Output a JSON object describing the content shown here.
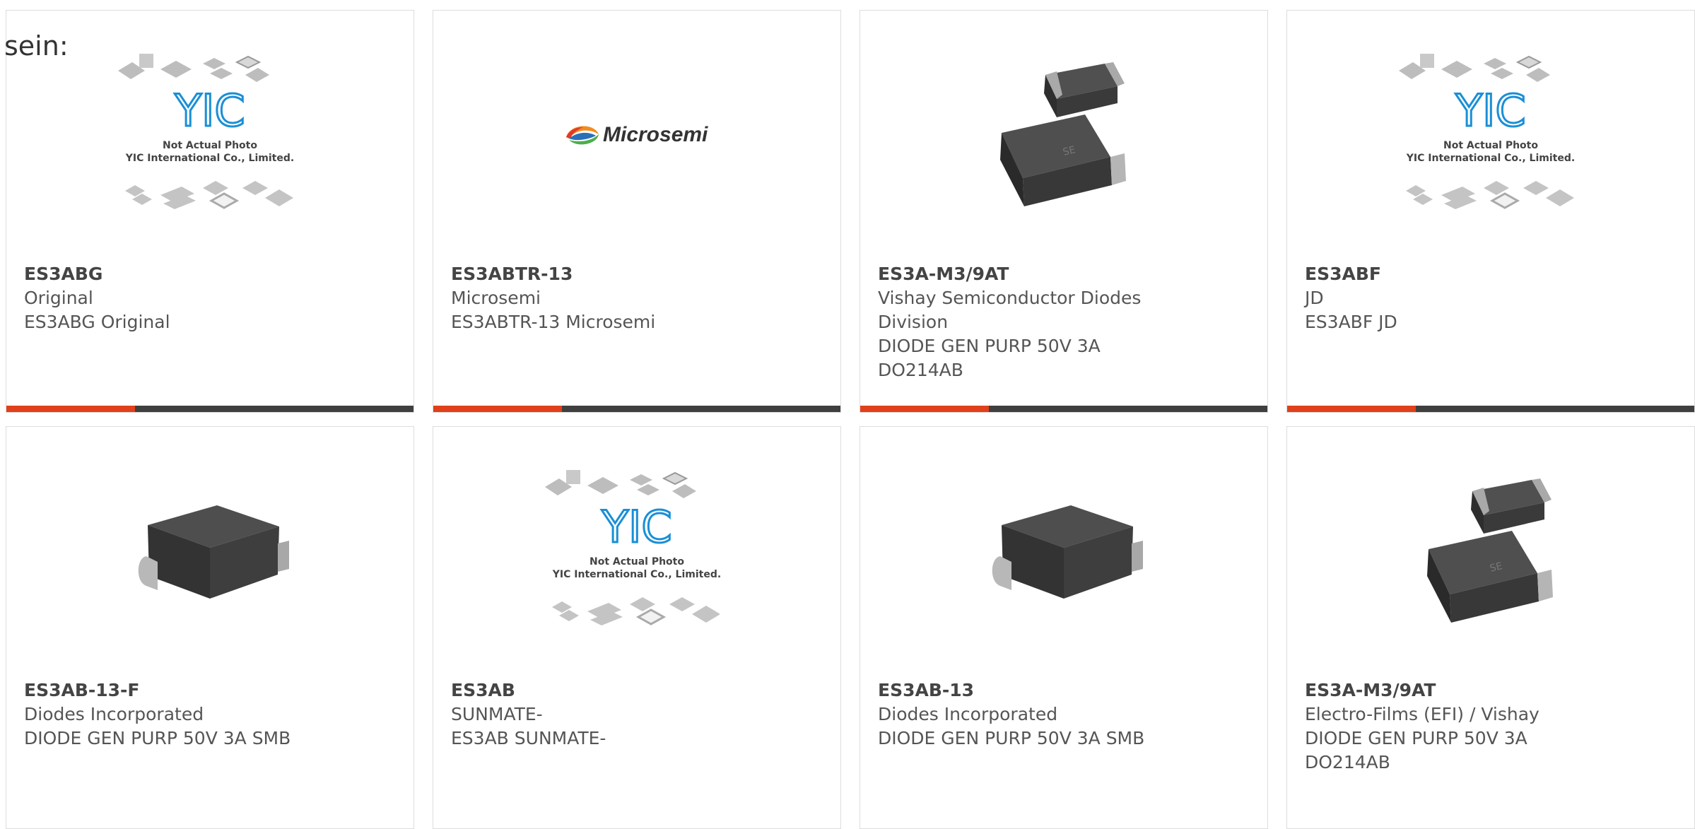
{
  "intro_text": "sein:",
  "colors": {
    "accent": "#e0401a",
    "bar": "#3f3f3f",
    "border": "#dddddd",
    "text": "#555555"
  },
  "products": [
    {
      "part_number": "ES3ABG",
      "manufacturer": "Original",
      "description": "ES3ABG Original",
      "image": "yic-placeholder-icon",
      "yic_text": {
        "logo": "YIC",
        "line1": "Not Actual Photo",
        "line2": "YIC International Co., Limited."
      }
    },
    {
      "part_number": "ES3ABTR-13",
      "manufacturer": "Microsemi",
      "description": "ES3ABTR-13 Microsemi",
      "image": "microsemi-logo-icon",
      "logo_text": "Microsemi"
    },
    {
      "part_number": "ES3A-M3/9AT",
      "manufacturer": "Vishay Semiconductor Diodes Division",
      "description": "DIODE GEN PURP 50V 3A DO214AB",
      "image": "smc-diode-pair-icon"
    },
    {
      "part_number": "ES3ABF",
      "manufacturer": "JD",
      "description": "ES3ABF JD",
      "image": "yic-placeholder-icon",
      "yic_text": {
        "logo": "YIC",
        "line1": "Not Actual Photo",
        "line2": "YIC International Co., Limited."
      }
    },
    {
      "part_number": "ES3AB-13-F",
      "manufacturer": "Diodes Incorporated",
      "description": "DIODE GEN PURP 50V 3A SMB",
      "image": "smb-diode-icon"
    },
    {
      "part_number": "ES3AB",
      "manufacturer": "SUNMATE-",
      "description": "ES3AB SUNMATE-",
      "image": "yic-placeholder-icon",
      "yic_text": {
        "logo": "YIC",
        "line1": "Not Actual Photo",
        "line2": "YIC International Co., Limited."
      }
    },
    {
      "part_number": "ES3AB-13",
      "manufacturer": "Diodes Incorporated",
      "description": "DIODE GEN PURP 50V 3A SMB",
      "image": "smb-diode-icon"
    },
    {
      "part_number": "ES3A-M3/9AT",
      "manufacturer": "Electro-Films (EFI) / Vishay",
      "description": "DIODE GEN PURP 50V 3A DO214AB",
      "image": "smc-diode-pair-icon"
    }
  ]
}
